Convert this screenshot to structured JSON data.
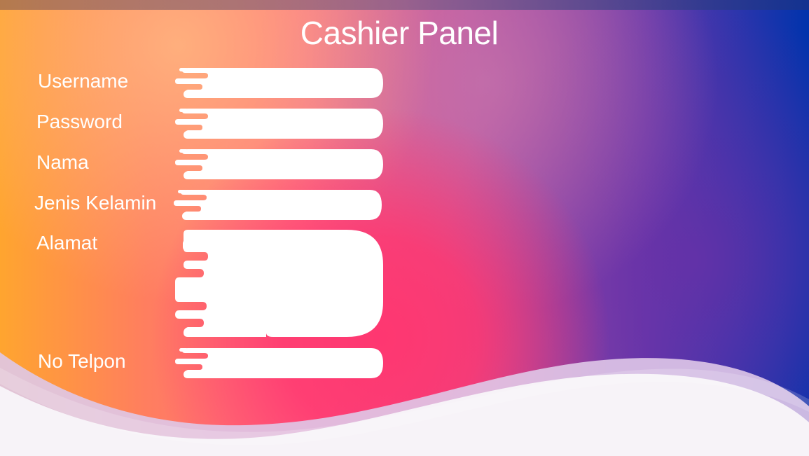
{
  "window": {
    "title": "Cashier Panel"
  },
  "form": {
    "fields": [
      {
        "label": "Username",
        "value": "",
        "placeholder": ""
      },
      {
        "label": "Password",
        "value": "",
        "placeholder": ""
      },
      {
        "label": "Nama",
        "value": "",
        "placeholder": ""
      },
      {
        "label": "Jenis Kelamin",
        "value": "",
        "placeholder": ""
      },
      {
        "label": "Alamat",
        "value": "",
        "placeholder": ""
      },
      {
        "label": "No Telpon",
        "value": "",
        "placeholder": ""
      }
    ]
  },
  "colors": {
    "label_text": "#ffffff",
    "input_fill": "#ffffff",
    "wave_front": "#f7f3f8",
    "wave_back": "#dfc8e8"
  },
  "icons": {
    "input_edge": "input-cutout-icon"
  }
}
